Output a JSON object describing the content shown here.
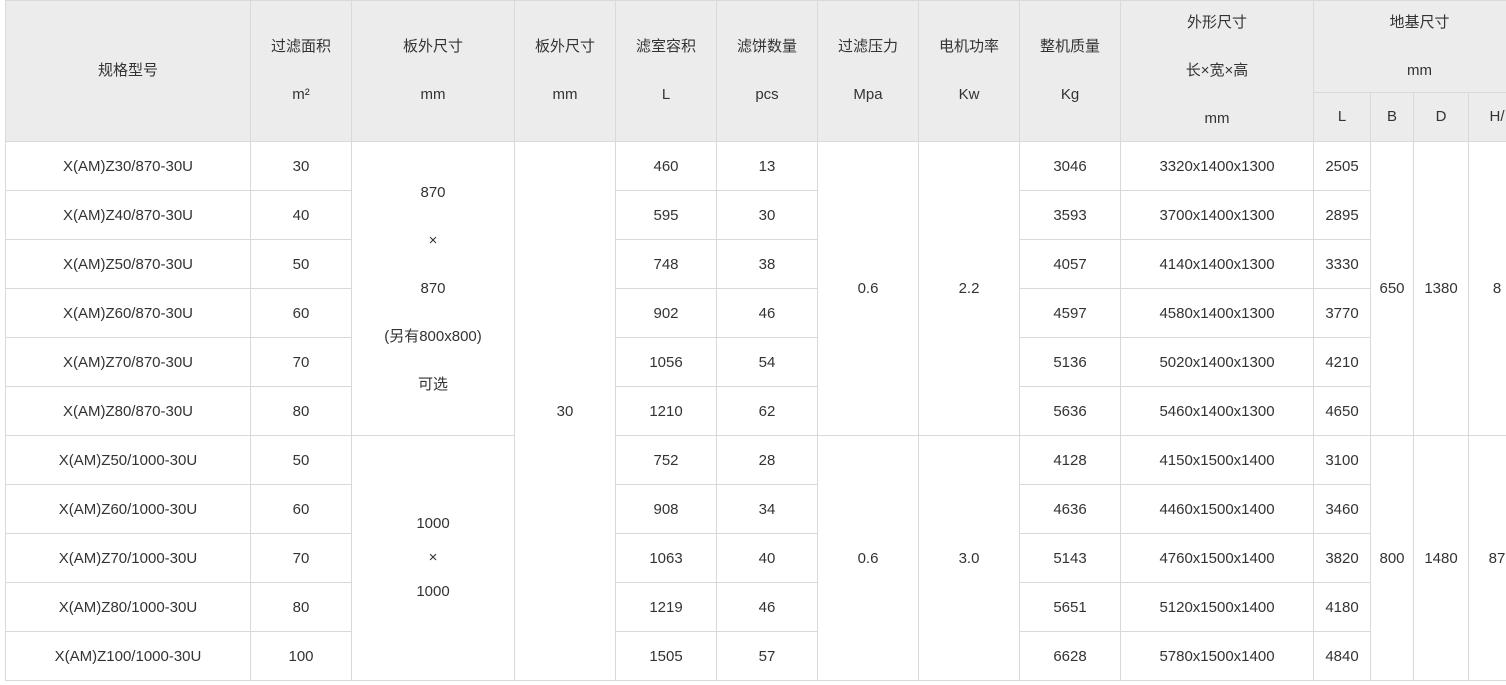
{
  "header": {
    "model": "规格型号",
    "filter_area": {
      "label": "过滤面积",
      "unit": "m²"
    },
    "plate_size": {
      "label": "板外尺寸",
      "unit": "mm"
    },
    "plate_size2": {
      "label": "板外尺寸",
      "unit": "mm"
    },
    "chamber_volume": {
      "label": "滤室容积",
      "unit": "L"
    },
    "cake_count": {
      "label": "滤饼数量",
      "unit": "pcs"
    },
    "filter_pressure": {
      "label": "过滤压力",
      "unit": "Mpa"
    },
    "motor_power": {
      "label": "电机功率",
      "unit": "Kw"
    },
    "machine_weight": {
      "label": "整机质量",
      "unit": "Kg"
    },
    "overall_size": {
      "label": "外形尺寸",
      "sub": "长×宽×高",
      "unit": "mm"
    },
    "foundation_size": {
      "label": "地基尺寸",
      "unit": "mm",
      "cols": [
        "L",
        "B",
        "D",
        "H/"
      ]
    }
  },
  "groups": [
    {
      "plate_lines": [
        "870",
        "×",
        "870",
        "(另有800x800)",
        "可选"
      ],
      "pressure": "0.6",
      "power": "2.2",
      "B": "650",
      "D": "1380",
      "H": "8",
      "rows": [
        {
          "model": "X(AM)Z30/870-30U",
          "area": "30",
          "volume": "460",
          "cakes": "13",
          "weight": "3046",
          "dims": "3320x1400x1300",
          "L": "2505"
        },
        {
          "model": "X(AM)Z40/870-30U",
          "area": "40",
          "volume": "595",
          "cakes": "30",
          "weight": "3593",
          "dims": "3700x1400x1300",
          "L": "2895"
        },
        {
          "model": "X(AM)Z50/870-30U",
          "area": "50",
          "volume": "748",
          "cakes": "38",
          "weight": "4057",
          "dims": "4140x1400x1300",
          "L": "3330"
        },
        {
          "model": "X(AM)Z60/870-30U",
          "area": "60",
          "volume": "902",
          "cakes": "46",
          "weight": "4597",
          "dims": "4580x1400x1300",
          "L": "3770"
        },
        {
          "model": "X(AM)Z70/870-30U",
          "area": "70",
          "volume": "1056",
          "cakes": "54",
          "weight": "5136",
          "dims": "5020x1400x1300",
          "L": "4210"
        },
        {
          "model": "X(AM)Z80/870-30U",
          "area": "80",
          "volume": "1210",
          "cakes": "62",
          "weight": "5636",
          "dims": "5460x1400x1300",
          "L": "4650"
        }
      ]
    },
    {
      "plate_lines": [
        "1000",
        "×",
        "1000"
      ],
      "pressure": "0.6",
      "power": "3.0",
      "B": "800",
      "D": "1480",
      "H": "87",
      "rows": [
        {
          "model": "X(AM)Z50/1000-30U",
          "area": "50",
          "volume": "752",
          "cakes": "28",
          "weight": "4128",
          "dims": "4150x1500x1400",
          "L": "3100"
        },
        {
          "model": "X(AM)Z60/1000-30U",
          "area": "60",
          "volume": "908",
          "cakes": "34",
          "weight": "4636",
          "dims": "4460x1500x1400",
          "L": "3460"
        },
        {
          "model": "X(AM)Z70/1000-30U",
          "area": "70",
          "volume": "1063",
          "cakes": "40",
          "weight": "5143",
          "dims": "4760x1500x1400",
          "L": "3820"
        },
        {
          "model": "X(AM)Z80/1000-30U",
          "area": "80",
          "volume": "1219",
          "cakes": "46",
          "weight": "5651",
          "dims": "5120x1500x1400",
          "L": "4180"
        },
        {
          "model": "X(AM)Z100/1000-30U",
          "area": "100",
          "volume": "1505",
          "cakes": "57",
          "weight": "6628",
          "dims": "5780x1500x1400",
          "L": "4840"
        }
      ]
    }
  ],
  "plate_size2_value": "30"
}
